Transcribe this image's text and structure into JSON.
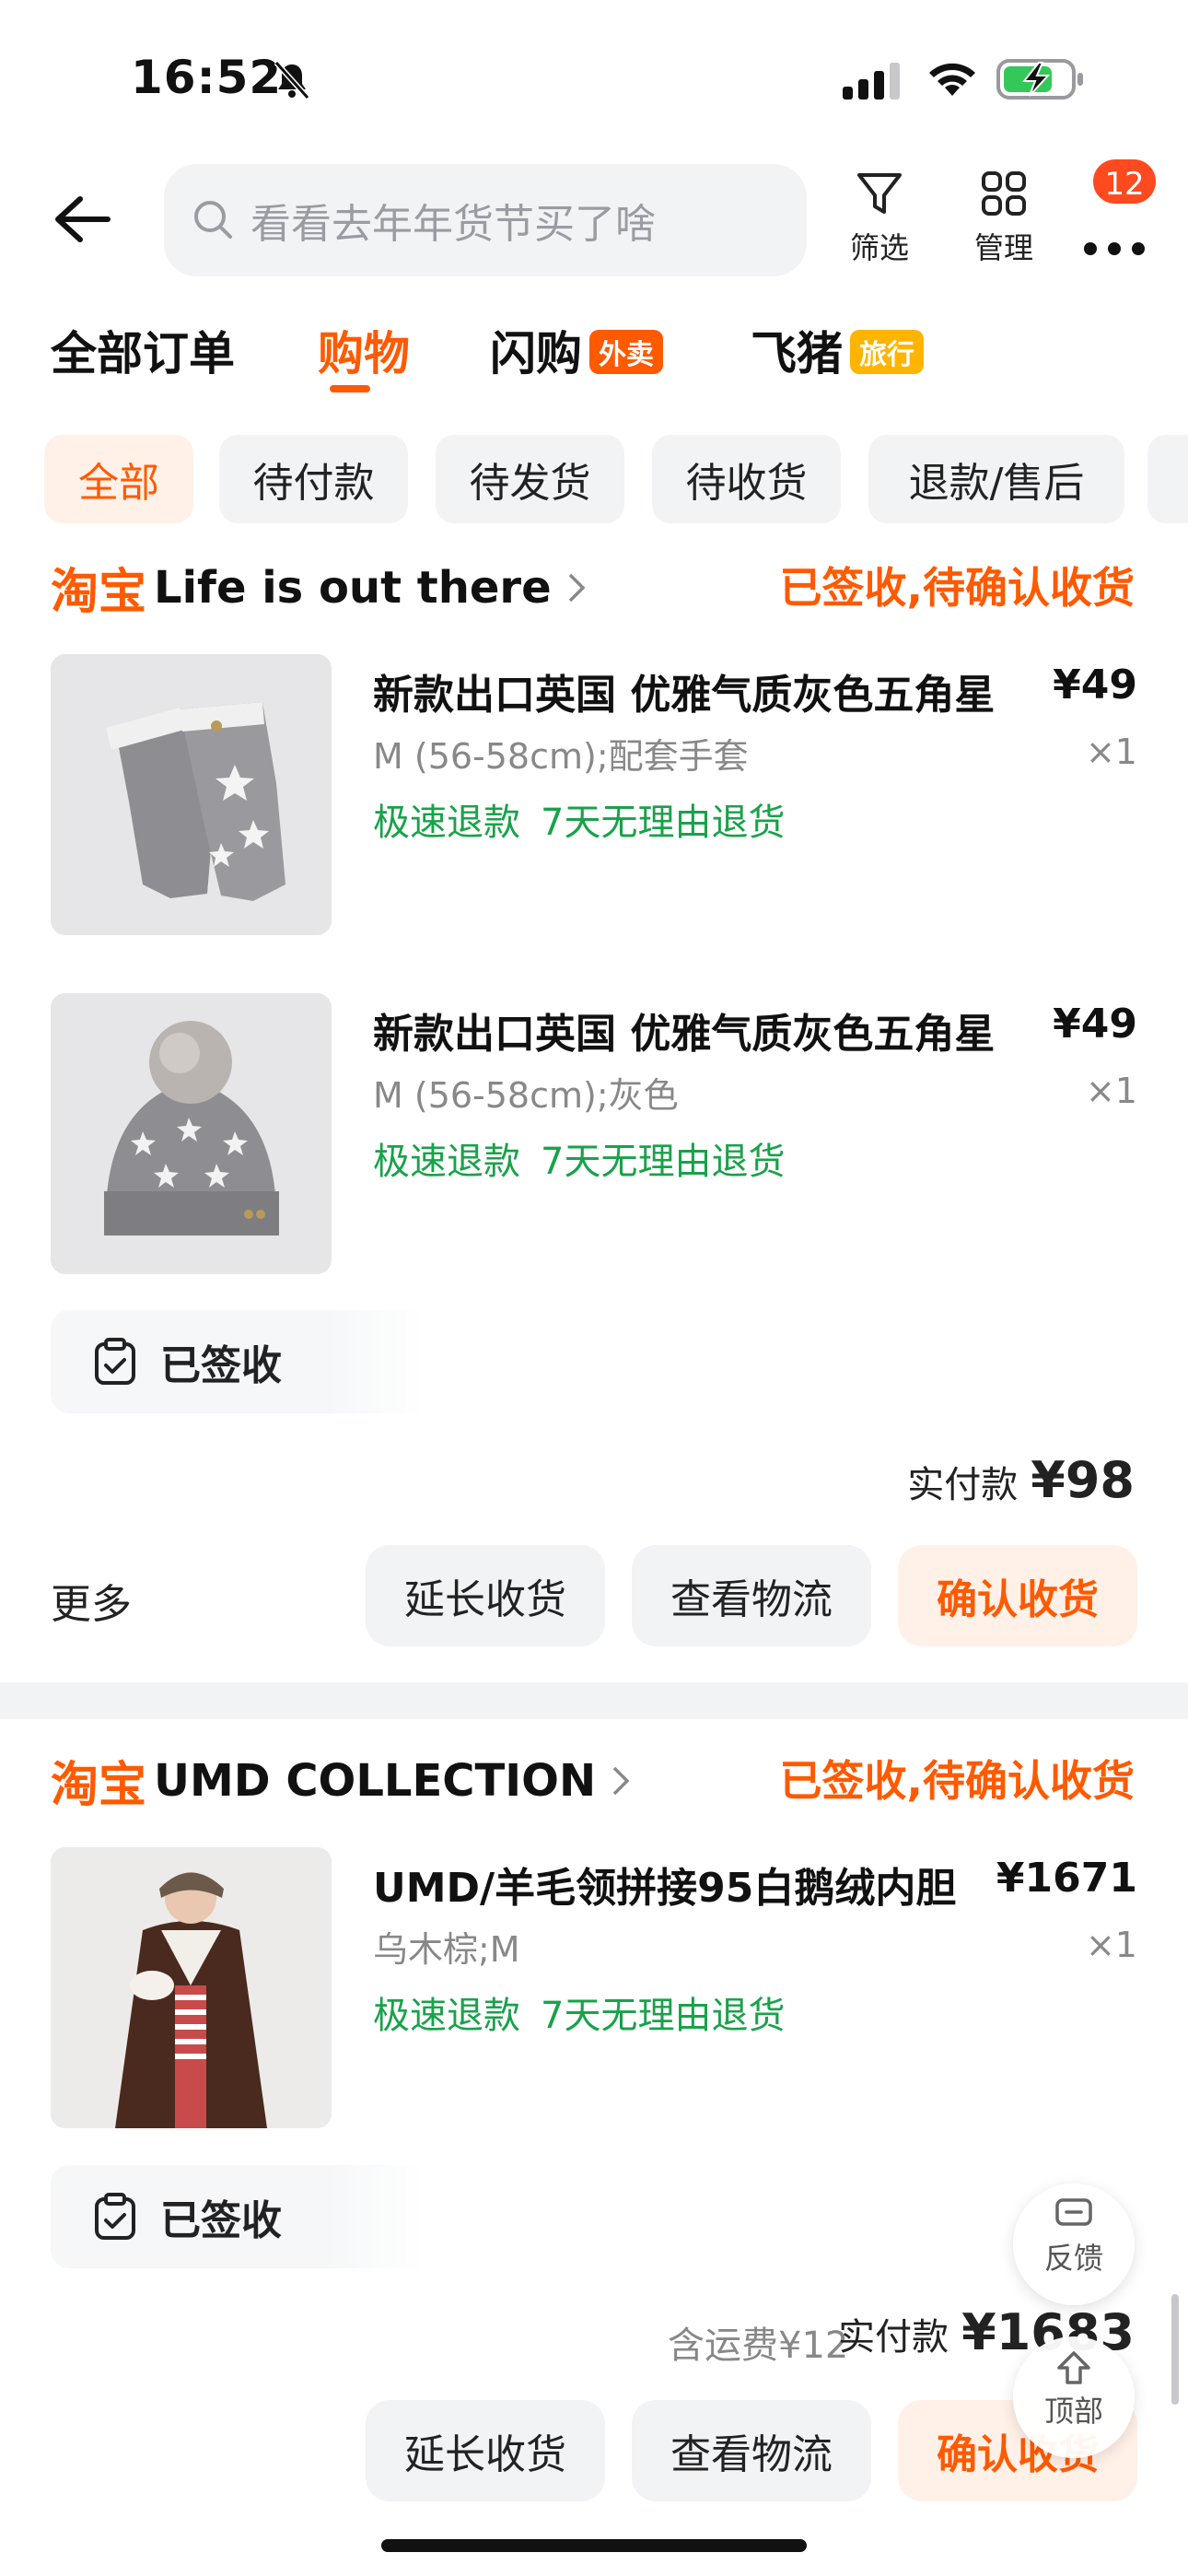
{
  "status_bar": {
    "time": "16:52"
  },
  "header": {
    "search_placeholder": "看看去年年货节买了啥",
    "filter_label": "筛选",
    "manage_label": "管理",
    "badge_count": "12"
  },
  "tabs": [
    {
      "label": "全部订单"
    },
    {
      "label": "购物"
    },
    {
      "label": "闪购",
      "tag": "外卖"
    },
    {
      "label": "飞猪",
      "tag": "旅行"
    }
  ],
  "filters": [
    "全部",
    "待付款",
    "待发货",
    "待收货",
    "退款/售后"
  ],
  "orders": [
    {
      "shop_logo": "淘宝",
      "shop_name": "Life is out there",
      "status": "已签收,待确认收货",
      "items": [
        {
          "title": "新款出口英国 优雅气质灰色五角星",
          "price": "¥49",
          "sku": "M (56-58cm);配套手套",
          "qty": "×1",
          "tag1": "极速退款",
          "tag2": "7天无理由退货"
        },
        {
          "title": "新款出口英国 优雅气质灰色五角星",
          "price": "¥49",
          "sku": "M (56-58cm);灰色",
          "qty": "×1",
          "tag1": "极速退款",
          "tag2": "7天无理由退货"
        }
      ],
      "sign_text": "已签收",
      "paid_label": "实付款",
      "paid_amount": "¥98",
      "more_label": "更多",
      "btn_extend": "延长收货",
      "btn_logistics": "查看物流",
      "btn_confirm": "确认收货"
    },
    {
      "shop_logo": "淘宝",
      "shop_name": "UMD COLLECTION",
      "status": "已签收,待确认收货",
      "items": [
        {
          "title": "UMD/羊毛领拼接95白鹅绒内胆",
          "price": "¥1671",
          "sku": "乌木棕;M",
          "qty": "×1",
          "tag1": "极速退款",
          "tag2": "7天无理由退货"
        }
      ],
      "sign_text": "已签收",
      "freight": "含运费¥12",
      "paid_label": "实付款",
      "paid_amount": "¥1683",
      "btn_extend": "延长收货",
      "btn_logistics": "查看物流",
      "btn_confirm": "确认收货"
    }
  ],
  "floating": {
    "feedback": "反馈",
    "top": "顶部"
  },
  "colors": {
    "accent": "#ff5a00",
    "green": "#19a24a",
    "badge": "#ff4a1f",
    "tag_orange": "#ff5a00",
    "tag_yellow": "#ffb400"
  }
}
